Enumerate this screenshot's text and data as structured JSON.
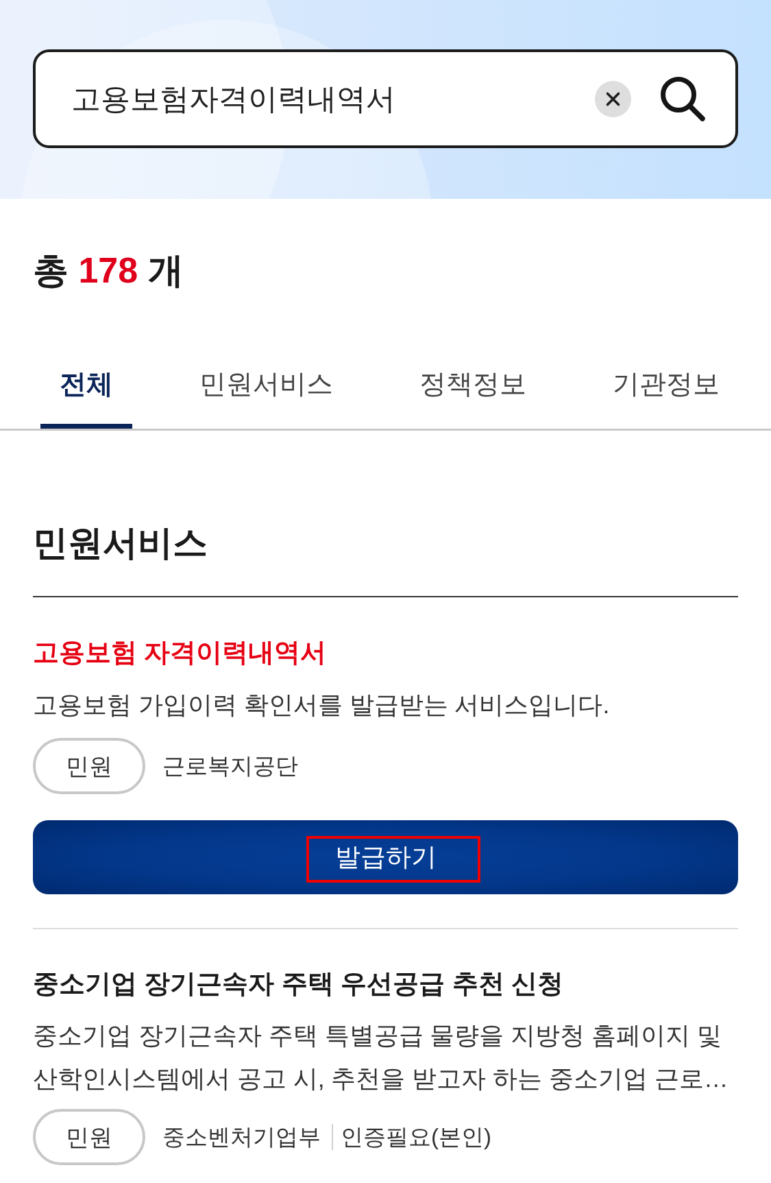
{
  "search": {
    "value": "고용보험자격이력내역서"
  },
  "summary": {
    "label": "총",
    "count": "178",
    "unit": "개"
  },
  "tabs": [
    {
      "label": "전체",
      "selected": true
    },
    {
      "label": "민원서비스",
      "selected": false
    },
    {
      "label": "정책정보",
      "selected": false
    },
    {
      "label": "기관정보",
      "selected": false
    }
  ],
  "section": {
    "title": "민원서비스",
    "items": [
      {
        "title": "고용보험 자격이력내역서",
        "highlighted": true,
        "description": "고용보험 가입이력 확인서를 발급받는 서비스입니다.",
        "tag": "민원",
        "agency": "근로복지공단",
        "button": {
          "label": "발급하기",
          "highlighted": true
        }
      },
      {
        "title": "중소기업 장기근속자 주택 우선공급 추천 신청",
        "highlighted": false,
        "description": "중소기업 장기근속자 주택 특별공급 물량을 지방청 홈페이지 및 산학인시스템에서 공고 시, 추천을 받고자 하는 중소기업 근로…",
        "tag": "민원",
        "agency": "중소벤처기업부",
        "requirement": "인증필요(본인)"
      }
    ]
  }
}
